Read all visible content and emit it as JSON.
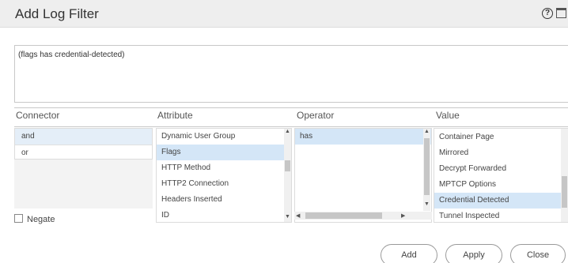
{
  "dialog": {
    "title": "Add Log Filter",
    "help_icon": "help-icon",
    "maximize_icon": "maximize-icon"
  },
  "filter": {
    "expression": "(flags has credential-detected)"
  },
  "columns": {
    "connector": "Connector",
    "attribute": "Attribute",
    "operator": "Operator",
    "value": "Value"
  },
  "connector": {
    "items": [
      "and",
      "or"
    ],
    "selected": "and",
    "negate_label": "Negate"
  },
  "attribute": {
    "items": [
      "Dynamic User Group",
      "Flags",
      "HTTP Method",
      "HTTP2 Connection",
      "Headers Inserted",
      "ID"
    ],
    "selected": "Flags"
  },
  "operator": {
    "items": [
      "has"
    ],
    "selected": "has"
  },
  "value": {
    "items": [
      "Container Page",
      "Mirrored",
      "Decrypt Forwarded",
      "MPTCP Options",
      "Credential Detected",
      "Tunnel Inspected"
    ],
    "selected": "Credential Detected"
  },
  "buttons": {
    "add": "Add",
    "apply": "Apply",
    "close": "Close"
  }
}
